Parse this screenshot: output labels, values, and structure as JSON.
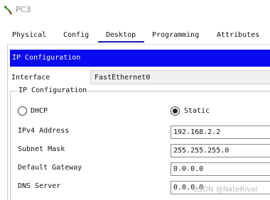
{
  "window": {
    "title": "PC3",
    "icon": "packet-tracer-pc-icon"
  },
  "tabs": [
    {
      "label": "Physical"
    },
    {
      "label": "Config"
    },
    {
      "label": "Desktop"
    },
    {
      "label": "Programming"
    },
    {
      "label": "Attributes"
    }
  ],
  "active_tab": "Desktop",
  "header": {
    "title": "IP Configuration"
  },
  "interface": {
    "label": "Interface",
    "value": "FastEthernet0"
  },
  "group": {
    "legend": "IP Configuration",
    "dhcp_label": "DHCP",
    "static_label": "Static",
    "selected": "Static"
  },
  "fields": {
    "ipv4": {
      "label": "IPv4 Address",
      "value": "192.168.2.2"
    },
    "subnet": {
      "label": "Subnet Mask",
      "value": "255.255.255.0"
    },
    "gateway": {
      "label": "Default Gateway",
      "value": "0.0.0.0"
    },
    "dns": {
      "label": "DNS Server",
      "value": "0.0.0.0"
    }
  },
  "watermark": "CSDN @NateRival",
  "colors": {
    "header_bg": "#0a0af0",
    "tab_underline": "#1a1aa6"
  }
}
